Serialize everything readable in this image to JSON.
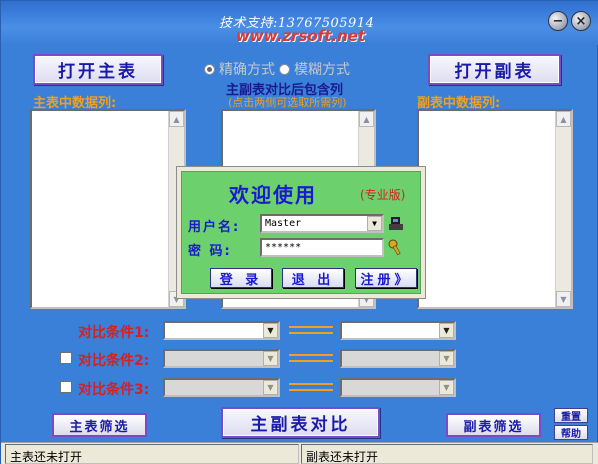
{
  "titlebar": {
    "support_text": "技术支持:13767505914",
    "website": "www.zrsoft.net",
    "minimize_symbol": "−",
    "close_symbol": "×"
  },
  "buttons": {
    "open_main": "打开主表",
    "open_sub": "打开副表",
    "compare": "主副表对比",
    "main_filter": "主表筛选",
    "sub_filter": "副表筛选",
    "reset": "重置",
    "help": "帮助"
  },
  "labels": {
    "main_columns": "主表中数据列:",
    "sub_columns": "副表中数据列:",
    "mode_exact": "精确方式",
    "mode_fuzzy": "模糊方式",
    "include_title": "主副表对比后包含列",
    "include_hint": "(点击两侧可选取所需列)"
  },
  "conditions": [
    {
      "label": "对比条件1:",
      "checkbox": false,
      "enabled": true
    },
    {
      "label": "对比条件2:",
      "checkbox": true,
      "enabled": false
    },
    {
      "label": "对比条件3:",
      "checkbox": true,
      "enabled": false
    }
  ],
  "status": {
    "main": "主表还未打开",
    "sub": "副表还未打开"
  },
  "login": {
    "title": "欢迎使用",
    "edition": "(专业版)",
    "username_label": "用户名:",
    "password_label": "密  码:",
    "username_value": "Master",
    "password_value": "******",
    "login_button": "登 录",
    "exit_button": "退 出",
    "register_button": "注册》"
  },
  "colors": {
    "window_bg": "#3a7fd8",
    "accent_orange": "#f0a020",
    "condition_red": "#d82020",
    "button_text": "#1a1aa8",
    "login_bg": "#6cd06c"
  }
}
